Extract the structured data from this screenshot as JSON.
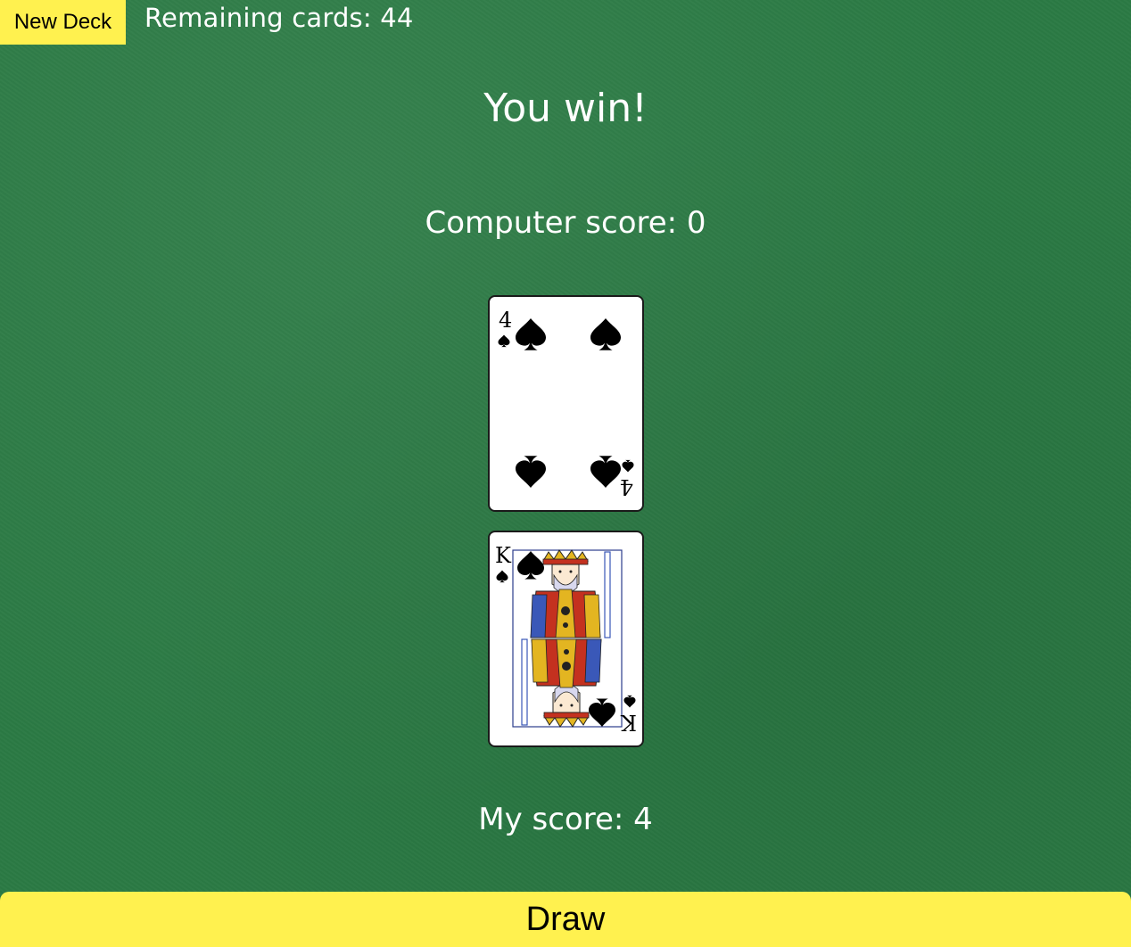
{
  "controls": {
    "new_deck_label": "New Deck",
    "draw_label": "Draw"
  },
  "status": {
    "remaining_text": "Remaining cards: 44",
    "headline": "You win!",
    "computer_score_text": "Computer score: 0",
    "my_score_text": "My score: 4"
  },
  "cards": {
    "computer": {
      "rank": "4",
      "suit": "spades",
      "suit_symbol": "♠"
    },
    "player": {
      "rank": "K",
      "suit": "spades",
      "suit_symbol": "♠"
    }
  },
  "colors": {
    "felt": "#2b7a44",
    "button": "#fff14f"
  }
}
